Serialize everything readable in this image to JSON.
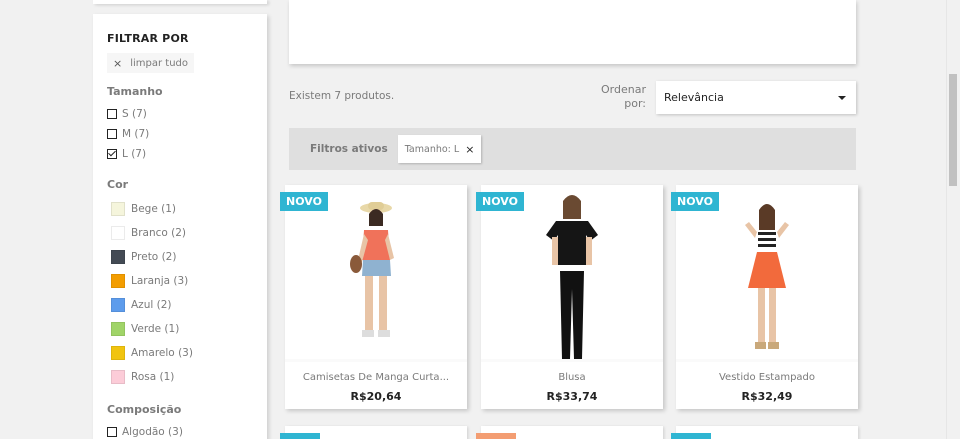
{
  "sidebar": {
    "title": "FILTRAR POR",
    "clear_all": "limpar tudo",
    "size": {
      "title": "Tamanho",
      "options": [
        {
          "label": "S (7)",
          "checked": false
        },
        {
          "label": "M (7)",
          "checked": false
        },
        {
          "label": "L (7)",
          "checked": true
        }
      ]
    },
    "color": {
      "title": "Cor",
      "options": [
        {
          "label": "Bege (1)",
          "color": "#f5f5dc"
        },
        {
          "label": "Branco (2)",
          "color": "#ffffff"
        },
        {
          "label": "Preto (2)",
          "color": "#434a54"
        },
        {
          "label": "Laranja (3)",
          "color": "#f39d00"
        },
        {
          "label": "Azul (2)",
          "color": "#5d9cec"
        },
        {
          "label": "Verde (1)",
          "color": "#a0d468"
        },
        {
          "label": "Amarelo (3)",
          "color": "#f1c40f"
        },
        {
          "label": "Rosa (1)",
          "color": "#fcccd8"
        }
      ]
    },
    "composition": {
      "title": "Composição",
      "options": [
        {
          "label": "Algodão (3)",
          "checked": false
        }
      ]
    }
  },
  "listing": {
    "total": "Existem 7 produtos.",
    "sort_label": "Ordenar por:",
    "sort_value": "Relevância"
  },
  "active_filters": {
    "label": "Filtros ativos",
    "chips": [
      "Tamanho: L"
    ]
  },
  "products": [
    {
      "flag": "NOVO",
      "name": "Camisetas De Manga Curta...",
      "price": "R$20,64"
    },
    {
      "flag": "NOVO",
      "name": "Blusa",
      "price": "R$33,74"
    },
    {
      "flag": "NOVO",
      "name": "Vestido Estampado",
      "price": "R$32,49"
    }
  ],
  "colors": {
    "accent": "#2fb5d2",
    "discount": "#f39d72",
    "text_dark": "#232323",
    "text_muted": "#7a7a7a"
  }
}
